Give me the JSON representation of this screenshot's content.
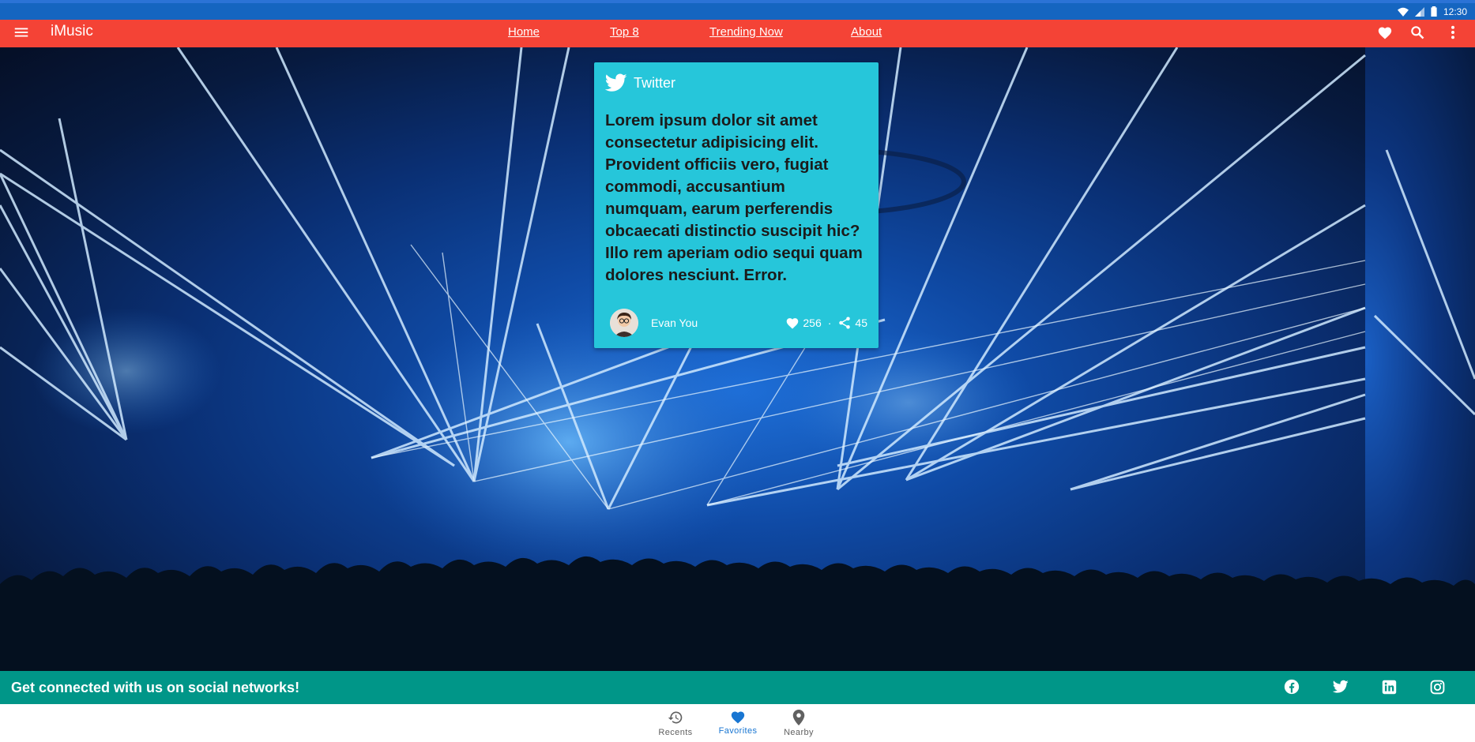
{
  "status_bar": {
    "time": "12:30",
    "icons": [
      "wifi-icon",
      "signal-icon",
      "battery-icon"
    ]
  },
  "app_bar": {
    "title": "iMusic",
    "color": "#f44336",
    "nav_links": [
      "Home",
      "Top 8",
      "Trending Now",
      "About"
    ],
    "actions": [
      "heart-icon",
      "search-icon",
      "more-vert-icon"
    ]
  },
  "hero": {
    "description_icon": "concert-laser-background"
  },
  "tweet_card": {
    "platform": "Twitter",
    "color": "#26c6da",
    "text": "Lorem ipsum dolor sit amet consectetur adipisicing elit. Provident officiis vero, fugiat commodi, accusantium numquam, earum perferendis obcaecati distinctio suscipit hic? Illo rem aperiam odio sequi quam dolores nesciunt. Error.",
    "author": "Evan You",
    "likes": "256",
    "separator": "·",
    "shares": "45"
  },
  "social_footer": {
    "text": "Get connected with us on social networks!",
    "color": "#009688",
    "icons": [
      "facebook-icon",
      "twitter-icon",
      "linkedin-icon",
      "instagram-icon"
    ]
  },
  "bottom_nav": {
    "items": [
      {
        "label": "Recents",
        "icon": "history-icon",
        "active": false
      },
      {
        "label": "Favorites",
        "icon": "heart-icon",
        "active": true
      },
      {
        "label": "Nearby",
        "icon": "location-pin-icon",
        "active": false
      }
    ],
    "active_color": "#1976d2"
  }
}
